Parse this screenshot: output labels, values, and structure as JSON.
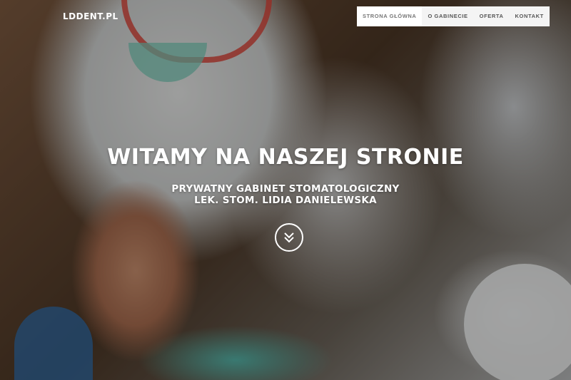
{
  "brand": "LDDENT.PL",
  "nav": {
    "items": [
      {
        "label": "STRONA GŁÓWNA",
        "active": true
      },
      {
        "label": "O GABINECIE",
        "active": false
      },
      {
        "label": "OFERTA",
        "active": false
      },
      {
        "label": "KONTAKT",
        "active": false
      }
    ]
  },
  "hero": {
    "title": "WITAMY NA NASZEJ STRONIE",
    "subtitle_line1": "PRYWATNY GABINET STOMATOLOGICZNY",
    "subtitle_line2": "LEK. STOM. LIDIA DANIELEWSKA",
    "scroll_icon": "double-chevron-down-icon"
  },
  "colors": {
    "nav_background": "#f4f4f4",
    "nav_active_background": "#ffffff",
    "hero_text": "#ffffff"
  }
}
